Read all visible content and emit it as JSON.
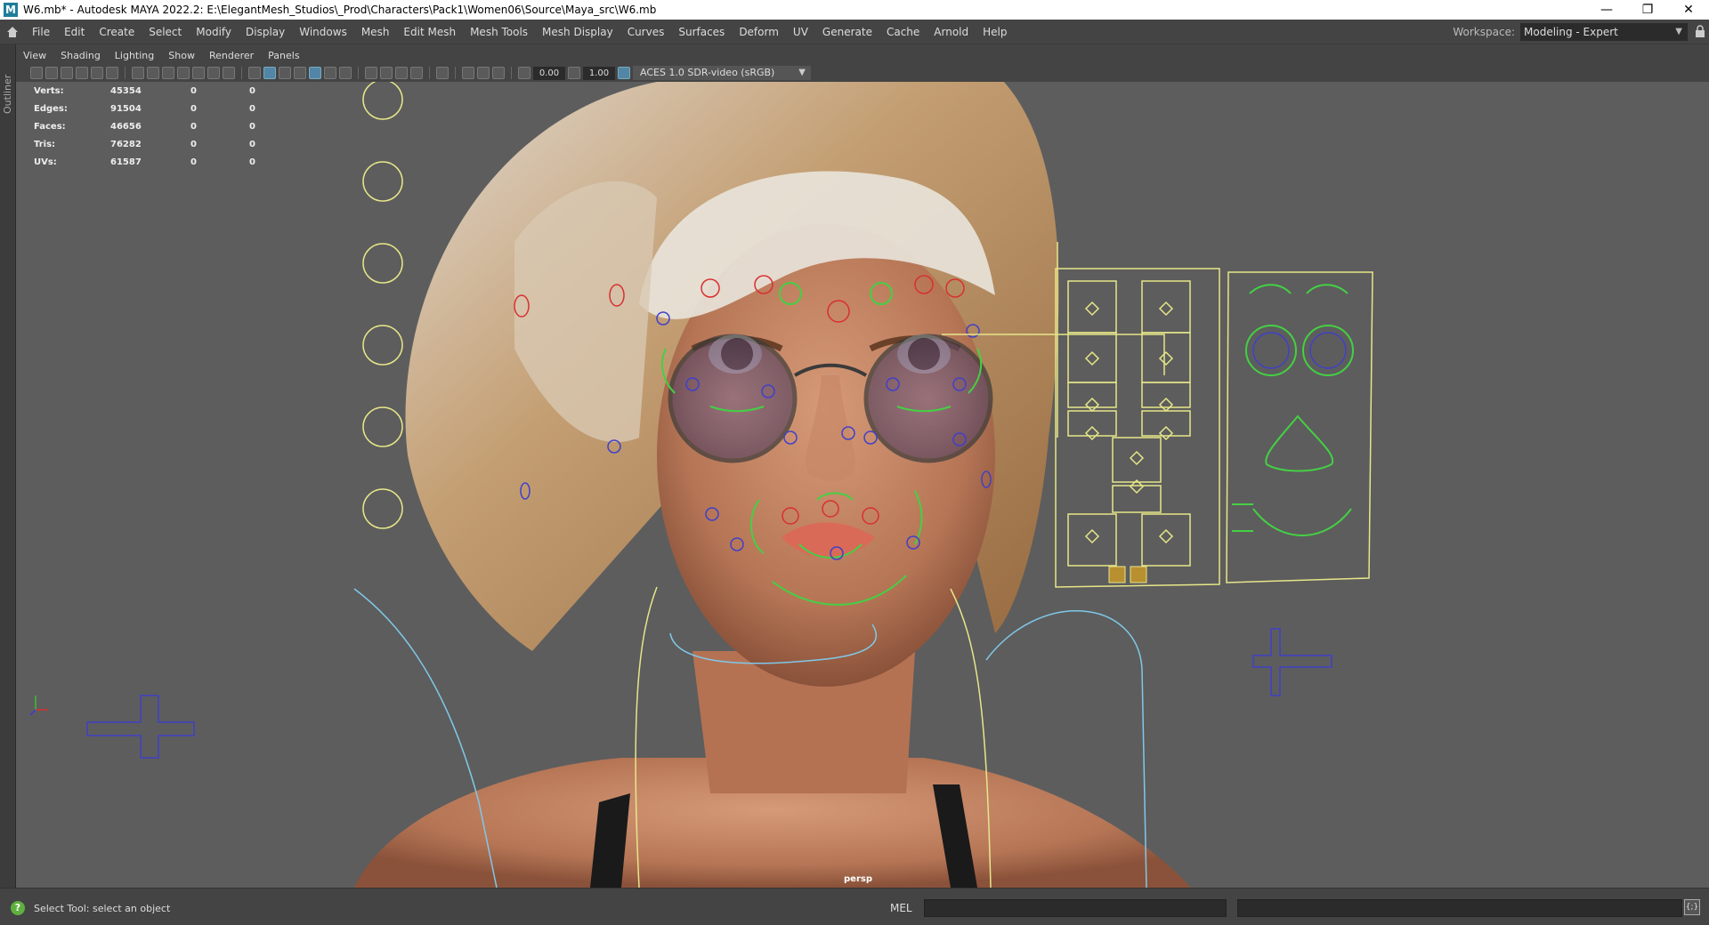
{
  "window": {
    "title": "W6.mb* - Autodesk MAYA 2022.2: E:\\ElegantMesh_Studios\\_Prod\\Characters\\Pack1\\Women06\\Source\\Maya_src\\W6.mb",
    "minimize": "—",
    "restore": "❐",
    "close": "✕"
  },
  "menubar": {
    "items": [
      "File",
      "Edit",
      "Create",
      "Select",
      "Modify",
      "Display",
      "Windows",
      "Mesh",
      "Edit Mesh",
      "Mesh Tools",
      "Mesh Display",
      "Curves",
      "Surfaces",
      "Deform",
      "UV",
      "Generate",
      "Cache",
      "Arnold",
      "Help"
    ],
    "workspace_label": "Workspace:",
    "workspace_value": "Modeling - Expert"
  },
  "outliner_tab": "Outliner",
  "panel_menu": [
    "View",
    "Shading",
    "Lighting",
    "Show",
    "Renderer",
    "Panels"
  ],
  "toolbar": {
    "field_1": "0.00",
    "field_2": "1.00",
    "color_space": "ACES 1.0 SDR-video (sRGB)"
  },
  "hud": [
    {
      "label": "Verts:",
      "v1": "45354",
      "v2": "0",
      "v3": "0"
    },
    {
      "label": "Edges:",
      "v1": "91504",
      "v2": "0",
      "v3": "0"
    },
    {
      "label": "Faces:",
      "v1": "46656",
      "v2": "0",
      "v3": "0"
    },
    {
      "label": "Tris:",
      "v1": "76282",
      "v2": "0",
      "v3": "0"
    },
    {
      "label": "UVs:",
      "v1": "61587",
      "v2": "0",
      "v3": "0"
    }
  ],
  "camera_label": "persp",
  "statusbar": {
    "help_text": "Select Tool: select an object",
    "mel_label": "MEL"
  },
  "colors": {
    "viewport_bg": "#5d5d5d",
    "control_yellow": "#e6e68a",
    "control_green": "#44d044",
    "control_red": "#d83030",
    "control_blue": "#4040c8",
    "control_cyan": "#80c8e8"
  },
  "icons": [
    "maya-logo",
    "home-icon",
    "lock-icon",
    "help-icon",
    "script-editor-icon"
  ]
}
